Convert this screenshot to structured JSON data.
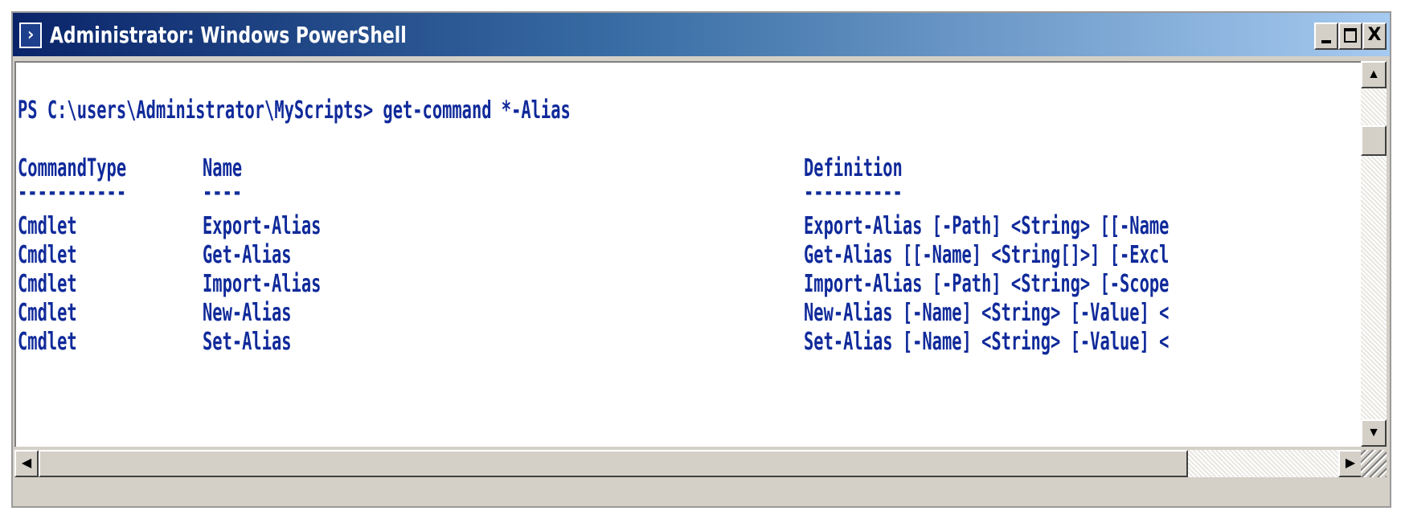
{
  "window": {
    "title": "Administrator: Windows PowerShell",
    "icon": "powershell-icon",
    "controls": {
      "minimize": "minimize-icon",
      "maximize": "maximize-icon",
      "close": "X"
    }
  },
  "console": {
    "prompt_line": "PS C:\\users\\Administrator\\MyScripts> get-command *-Alias",
    "headers": [
      "CommandType",
      "Name",
      "Definition"
    ],
    "separators": [
      "-----------",
      "----",
      "----------"
    ],
    "rows": [
      [
        "Cmdlet",
        "Export-Alias",
        "Export-Alias [-Path] <String> [[-Name"
      ],
      [
        "Cmdlet",
        "Get-Alias",
        "Get-Alias [[-Name] <String[]>] [-Excl"
      ],
      [
        "Cmdlet",
        "Import-Alias",
        "Import-Alias [-Path] <String> [-Scope"
      ],
      [
        "Cmdlet",
        "New-Alias",
        "New-Alias [-Name] <String> [-Value] <"
      ],
      [
        "Cmdlet",
        "Set-Alias",
        "Set-Alias [-Name] <String> [-Value] <"
      ]
    ],
    "colors": {
      "text": "#102a9a",
      "background": "#ffffff"
    }
  },
  "scrollbars": {
    "up_arrow": "▲",
    "down_arrow": "▼",
    "left_arrow": "◀",
    "right_arrow": "▶"
  }
}
